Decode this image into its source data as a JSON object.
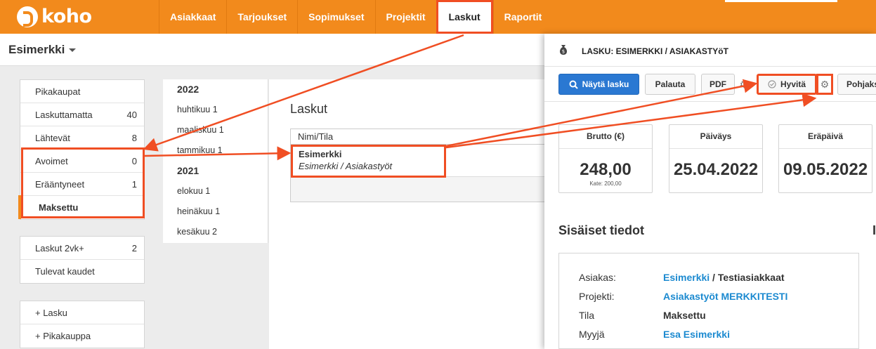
{
  "topbar": {
    "logo_text": "koho",
    "nav": [
      "Asiakkaat",
      "Tarjoukset",
      "Sopimukset",
      "Projektit",
      "Laskut",
      "Raportit"
    ],
    "active_nav": "Laskut",
    "brand_color": "#f28a1c"
  },
  "subheader": {
    "company": "Esimerkki"
  },
  "sidebar": {
    "group1": [
      {
        "label": "Pikakaupat",
        "count": ""
      },
      {
        "label": "Laskuttamatta",
        "count": "40"
      },
      {
        "label": "Lähtevät",
        "count": "8"
      },
      {
        "label": "Avoimet",
        "count": "0"
      },
      {
        "label": "Erääntyneet",
        "count": "1"
      },
      {
        "label": "Maksettu",
        "count": ""
      }
    ],
    "group2": [
      {
        "label": "Laskut 2vk+",
        "count": "2"
      },
      {
        "label": "Tulevat kaudet",
        "count": ""
      }
    ],
    "group3": [
      {
        "label": "+ Lasku"
      },
      {
        "label": "+ Pikakauppa"
      }
    ]
  },
  "periods": [
    {
      "year": "2022",
      "months": [
        "huhtikuu 1",
        "maaliskuu 1",
        "tammikuu 1"
      ]
    },
    {
      "year": "2021",
      "months": [
        "elokuu 1",
        "heinäkuu 1",
        "kesäkuu 2"
      ]
    }
  ],
  "center": {
    "title": "Laskut",
    "column_header": "Nimi/Tila",
    "row": {
      "name": "Esimerkki",
      "sub": "Esimerkki / Asiakastyöt"
    }
  },
  "panel": {
    "title": "LASKU: ESIMERKKI / ASIAKASTYöT",
    "icon": "money-bag-icon",
    "buttons": {
      "show": "Näytä lasku",
      "return": "Palauta",
      "pdf": "PDF",
      "credit": "Hyvitä",
      "template": "Pohjaks"
    },
    "stats": [
      {
        "label": "Brutto (€)",
        "value": "248,00",
        "sub": "Kate: 200,00"
      },
      {
        "label": "Päiväys",
        "value": "25.04.2022",
        "sub": ""
      },
      {
        "label": "Eräpäivä",
        "value": "09.05.2022",
        "sub": ""
      }
    ],
    "section_title": "Sisäiset tiedot",
    "section_title2": "I",
    "info": {
      "customer_label": "Asiakas:",
      "customer_link": "Esimerkki",
      "customer_rest": " / Testiasiakkaat",
      "project_label": "Projekti:",
      "project_value": "Asiakastyöt MERKKITESTI",
      "state_label": "Tila",
      "state_value": "Maksettu",
      "seller_label": "Myyjä",
      "seller_value": "Esa Esimerkki"
    }
  },
  "colors": {
    "highlight": "#f04e23",
    "primary_button": "#2a78d2",
    "link": "#1c8ad0"
  }
}
